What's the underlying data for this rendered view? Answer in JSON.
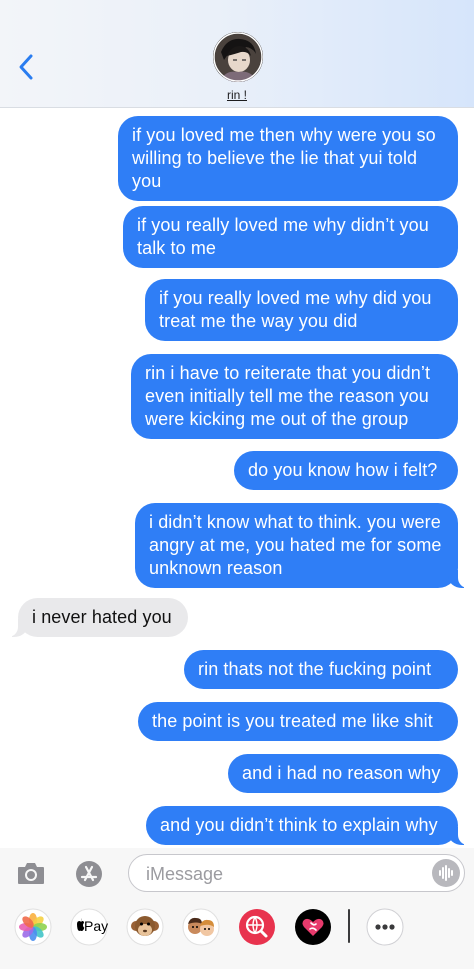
{
  "header": {
    "contact_name": "rin !"
  },
  "messages": [
    {
      "direction": "out",
      "text": "if you loved me then why were you so willing to believe the lie that yui told you"
    },
    {
      "direction": "out",
      "text": "if you really loved me why didn’t you talk to me"
    },
    {
      "direction": "out",
      "text": "if you really loved me why did you treat me the way you did"
    },
    {
      "direction": "out",
      "text": "rin i have to reiterate that you didn’t even initially tell me the reason you were kicking me out of the group"
    },
    {
      "direction": "out",
      "text": "do you know how i felt?"
    },
    {
      "direction": "out",
      "text": "i didn’t know what to think. you were angry at me, you hated me for some unknown reason"
    },
    {
      "direction": "in",
      "text": "i never hated you"
    },
    {
      "direction": "out",
      "text": "rin thats not the fucking point"
    },
    {
      "direction": "out",
      "text": "the point is you treated me like shit"
    },
    {
      "direction": "out",
      "text": "and i had no reason why"
    },
    {
      "direction": "out",
      "text": "and you didn’t think to explain why"
    }
  ],
  "input": {
    "placeholder": "iMessage",
    "value": ""
  },
  "app_strip": {
    "apple_pay_label": "Pay",
    "icons": [
      "photos-icon",
      "apple-pay-icon",
      "monkey-memoji-icon",
      "memoji-icon",
      "web-search-icon",
      "digital-touch-icon",
      "more-apps-icon"
    ]
  },
  "colors": {
    "outgoing_bubble": "#2f7ef6",
    "incoming_bubble": "#e9e9eb",
    "accent": "#1a73e8"
  }
}
